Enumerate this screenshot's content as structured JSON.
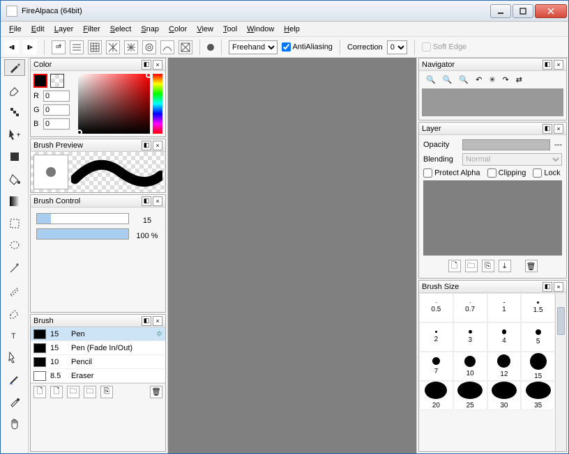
{
  "title": "FireAlpaca (64bit)",
  "menus": [
    "File",
    "Edit",
    "Layer",
    "Filter",
    "Select",
    "Snap",
    "Color",
    "View",
    "Tool",
    "Window",
    "Help"
  ],
  "toolbar": {
    "mode": "Freehand",
    "antialias_label": "AntiAliasing",
    "antialias_checked": true,
    "correction_label": "Correction",
    "correction_value": "0",
    "softedge_label": "Soft Edge",
    "softedge_checked": false
  },
  "panels": {
    "color": {
      "title": "Color",
      "r": "0",
      "g": "0",
      "b": "0",
      "r_label": "R",
      "g_label": "G",
      "b_label": "B",
      "primary": "#000000",
      "secondary_transparent": true
    },
    "brush_preview": {
      "title": "Brush Preview"
    },
    "brush_control": {
      "title": "Brush Control",
      "size_value": "15",
      "size_pct": 15,
      "opacity_value": "100 %",
      "opacity_pct": 100
    },
    "brush": {
      "title": "Brush",
      "items": [
        {
          "size": "15",
          "name": "Pen",
          "swatch": "#000",
          "selected": true
        },
        {
          "size": "15",
          "name": "Pen (Fade In/Out)",
          "swatch": "#000",
          "selected": false
        },
        {
          "size": "10",
          "name": "Pencil",
          "swatch": "#000",
          "selected": false
        },
        {
          "size": "8.5",
          "name": "Eraser",
          "swatch": "#fff",
          "selected": false
        }
      ]
    },
    "navigator": {
      "title": "Navigator"
    },
    "layer": {
      "title": "Layer",
      "opacity_label": "Opacity",
      "opacity_value": "---",
      "blending_label": "Blending",
      "blending_value": "Normal",
      "protect_label": "Protect Alpha",
      "clipping_label": "Clipping",
      "lock_label": "Lock"
    },
    "brush_size": {
      "title": "Brush Size",
      "sizes": [
        0.5,
        0.7,
        1,
        1.5,
        2,
        3,
        4,
        5,
        7,
        10,
        12,
        15,
        20,
        25,
        30,
        35
      ]
    }
  }
}
